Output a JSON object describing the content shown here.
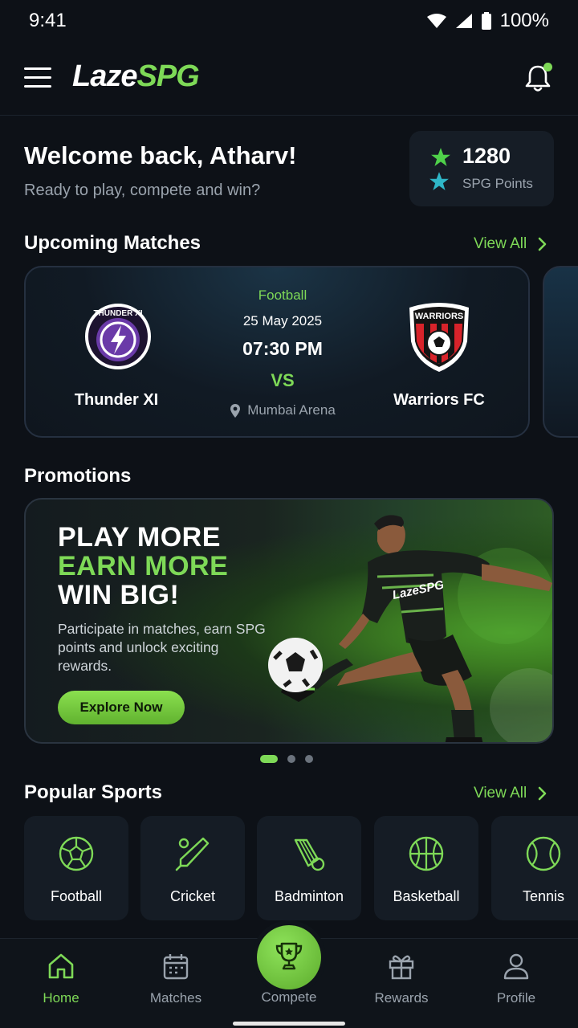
{
  "status_bar": {
    "time": "9:41",
    "battery": "100%"
  },
  "header": {
    "logo_part1": "Laze",
    "logo_part2": "SPG"
  },
  "welcome": {
    "title": "Welcome back, Atharv!",
    "subtitle": "Ready to play, compete and win?",
    "points_value": "1280",
    "points_label": "SPG Points"
  },
  "upcoming": {
    "title": "Upcoming Matches",
    "view_all": "View All",
    "match": {
      "sport": "Football",
      "date": "25 May 2025",
      "time": "07:30 PM",
      "vs": "VS",
      "venue": "Mumbai Arena",
      "team1": "Thunder XI",
      "team1_badge": "THUNDER XI",
      "team2": "Warriors FC",
      "team2_badge": "WARRIORS"
    }
  },
  "promotions": {
    "title": "Promotions",
    "line1": "PLAY MORE",
    "line2": "EARN MORE",
    "line3": "WIN BIG!",
    "description": "Participate in matches, earn SPG points and unlock exciting rewards.",
    "cta": "Explore Now",
    "jersey_text": "LazeSPG",
    "slides_total": 3,
    "active_slide": 1
  },
  "popular_sports": {
    "title": "Popular Sports",
    "view_all": "View All",
    "items": [
      {
        "label": "Football",
        "icon": "football-icon"
      },
      {
        "label": "Cricket",
        "icon": "cricket-icon"
      },
      {
        "label": "Badminton",
        "icon": "shuttlecock-icon"
      },
      {
        "label": "Basketball",
        "icon": "basketball-icon"
      },
      {
        "label": "Tennis",
        "icon": "tennis-ball-icon"
      }
    ]
  },
  "bottom_nav": {
    "items": [
      {
        "label": "Home",
        "icon": "home-icon",
        "active": true
      },
      {
        "label": "Matches",
        "icon": "calendar-icon",
        "active": false
      },
      {
        "label": "Compete",
        "icon": "trophy-icon",
        "active": false
      },
      {
        "label": "Rewards",
        "icon": "gift-icon",
        "active": false
      },
      {
        "label": "Profile",
        "icon": "user-icon",
        "active": false
      }
    ]
  },
  "colors": {
    "accent": "#7ed957",
    "background": "#0d1117",
    "card": "#151c25",
    "muted": "#9aa3ad"
  }
}
